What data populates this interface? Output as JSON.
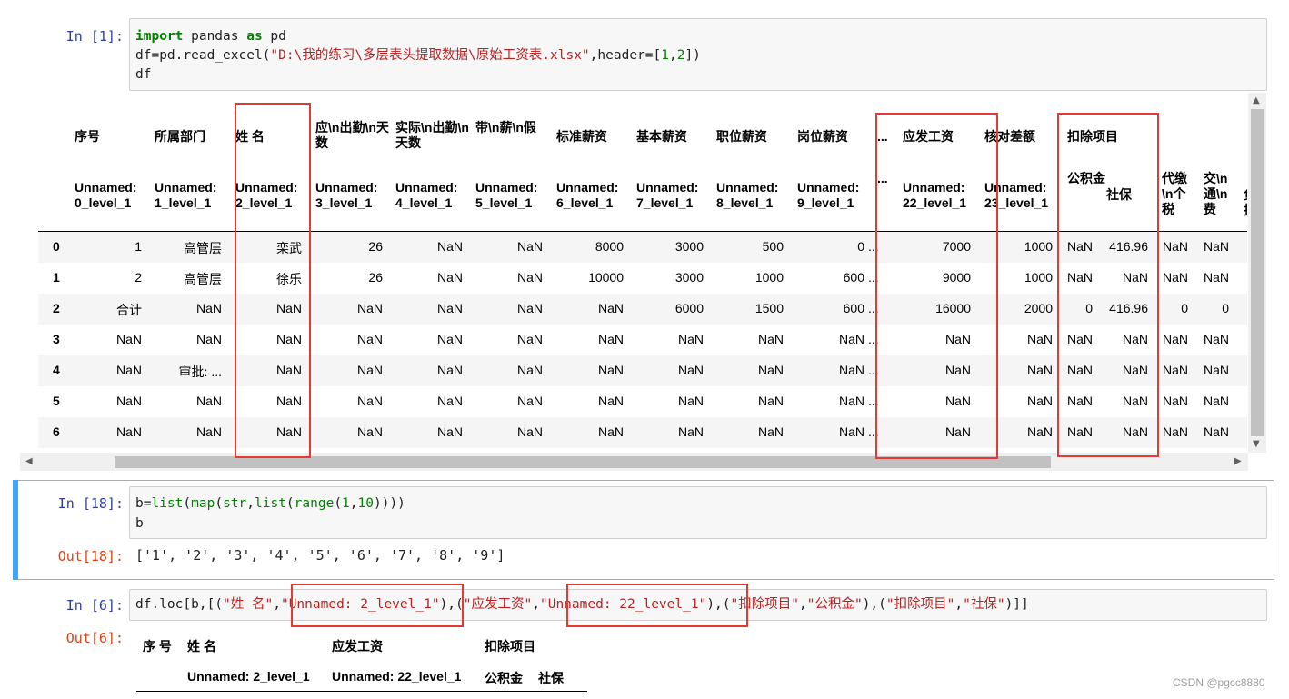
{
  "cells": {
    "cell1": {
      "prompt": "In  [1]:",
      "code": {
        "l1_kw1": "import",
        "l1_mid": " pandas ",
        "l1_kw2": "as",
        "l1_end": " pd",
        "l2_pre": "df=pd.read_excel(",
        "l2_str": "\"D:\\我的练习\\多层表头提取数据\\原始工资表.xlsx\"",
        "l2_mid": ",header=[",
        "l2_n1": "1",
        "l2_comma": ",",
        "l2_n2": "2",
        "l2_end": "])",
        "l3": "df"
      }
    },
    "dataframe": {
      "header_row1": [
        "序号",
        "所属部门",
        "姓 名",
        "应\\n出勤\\n天数",
        "实际\\n出勤\\n天数",
        "带\\n薪\\n假",
        "标准薪资",
        "基本薪资",
        "职位薪资",
        "岗位薪资",
        "...",
        "应发工资",
        "核对差额",
        "扣除项目"
      ],
      "header_row2": [
        "Unnamed: 0_level_1",
        "Unnamed: 1_level_1",
        "Unnamed: 2_level_1",
        "Unnamed: 3_level_1",
        "Unnamed: 4_level_1",
        "Unnamed: 5_level_1",
        "Unnamed: 6_level_1",
        "Unnamed: 7_level_1",
        "Unnamed: 8_level_1",
        "Unnamed: 9_level_1",
        "...",
        "Unnamed: 22_level_1",
        "Unnamed: 23_level_1",
        "公积金",
        "社保",
        "代缴\\n个税",
        "交\\n通\\n费",
        "负担"
      ],
      "index": [
        "0",
        "1",
        "2",
        "3",
        "4",
        "5",
        "6"
      ],
      "rows": [
        [
          "1",
          "高管层",
          "栾武",
          "26",
          "NaN",
          "NaN",
          "8000",
          "3000",
          "500",
          "0",
          "...",
          "7000",
          "1000",
          "NaN",
          "416.96",
          "NaN",
          "NaN",
          "N"
        ],
        [
          "2",
          "高管层",
          "徐乐",
          "26",
          "NaN",
          "NaN",
          "10000",
          "3000",
          "1000",
          "600",
          "...",
          "9000",
          "1000",
          "NaN",
          "NaN",
          "NaN",
          "NaN",
          "N"
        ],
        [
          "合计",
          "NaN",
          "NaN",
          "NaN",
          "NaN",
          "NaN",
          "NaN",
          "6000",
          "1500",
          "600",
          "...",
          "16000",
          "2000",
          "0",
          "416.96",
          "0",
          "0",
          ""
        ],
        [
          "NaN",
          "NaN",
          "NaN",
          "NaN",
          "NaN",
          "NaN",
          "NaN",
          "NaN",
          "NaN",
          "NaN",
          "...",
          "NaN",
          "NaN",
          "NaN",
          "NaN",
          "NaN",
          "NaN",
          "N"
        ],
        [
          "NaN",
          "审批: ...",
          "NaN",
          "NaN",
          "NaN",
          "NaN",
          "NaN",
          "NaN",
          "NaN",
          "NaN",
          "...",
          "NaN",
          "NaN",
          "NaN",
          "NaN",
          "NaN",
          "NaN",
          "N"
        ],
        [
          "NaN",
          "NaN",
          "NaN",
          "NaN",
          "NaN",
          "NaN",
          "NaN",
          "NaN",
          "NaN",
          "NaN",
          "...",
          "NaN",
          "NaN",
          "NaN",
          "NaN",
          "NaN",
          "NaN",
          "N"
        ],
        [
          "NaN",
          "NaN",
          "NaN",
          "NaN",
          "NaN",
          "NaN",
          "NaN",
          "NaN",
          "NaN",
          "NaN",
          "...",
          "NaN",
          "NaN",
          "NaN",
          "NaN",
          "NaN",
          "NaN",
          "N"
        ]
      ]
    },
    "cell2": {
      "prompt": "In  [18]:",
      "code_l1_a": "b=",
      "code_l1_b": "list",
      "code_l1_c": "(",
      "code_l1_d": "map",
      "code_l1_e": "(",
      "code_l1_f": "str",
      "code_l1_g": ",",
      "code_l1_h": "list",
      "code_l1_i": "(",
      "code_l1_j": "range",
      "code_l1_k": "(",
      "code_l1_n1": "1",
      "code_l1_l": ",",
      "code_l1_n2": "10",
      "code_l1_m": "))))",
      "code_l2": "b",
      "out_prompt": "Out[18]:",
      "output": "['1', '2', '3', '4', '5', '6', '7', '8', '9']"
    },
    "cell3": {
      "prompt": "In  [6]:",
      "code_a": "df.loc[b,[(",
      "code_s1": "\"姓 名\"",
      "code_c1": ",",
      "code_s2": "\"Unnamed: 2_level_1\"",
      "code_b": "),(",
      "code_s3": "\"应发工资\"",
      "code_c2": ",",
      "code_s4": "\"Unnamed: 22_level_1\"",
      "code_c": "),(",
      "code_s5": "\"扣除项目\"",
      "code_c3": ",",
      "code_s6": "\"公积金\"",
      "code_d": "),(",
      "code_s7": "\"扣除项目\"",
      "code_c4": ",",
      "code_s8": "\"社保\"",
      "code_e": ")]]",
      "out_prompt": "Out[6]:",
      "out_header1": [
        "序 号",
        "姓 名",
        "应发工资",
        "扣除项目"
      ],
      "out_header2": [
        "Unnamed: 2_level_1",
        "Unnamed: 22_level_1",
        "公积金",
        "社保"
      ]
    }
  },
  "watermark": "CSDN @pgcc8880",
  "colors": {
    "prompt_in": "#303f9f",
    "prompt_out": "#d84315",
    "highlight_box": "#e53935",
    "active_cell_bar": "#42a5f5"
  }
}
